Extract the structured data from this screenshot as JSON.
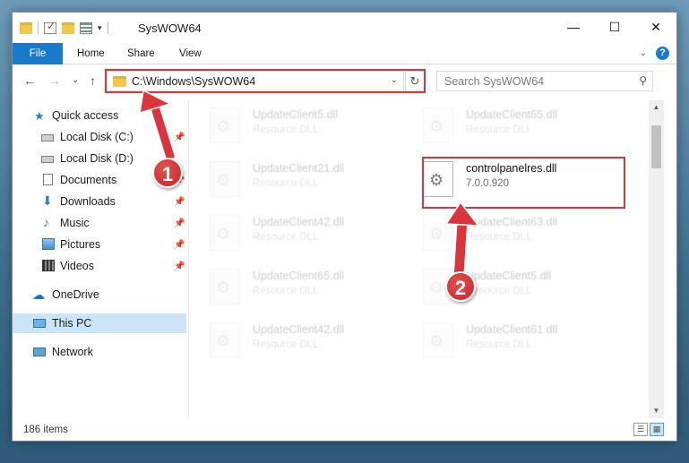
{
  "window": {
    "title": "SysWOW64",
    "minimize": "—",
    "maximize": "☐",
    "close": "✕"
  },
  "ribbon": {
    "tabs": [
      "File",
      "Home",
      "Share",
      "View"
    ],
    "expand": "⌄",
    "help": "?"
  },
  "nav": {
    "back": "←",
    "forward": "→",
    "recent": "⌄",
    "up": "↑",
    "address": "C:\\Windows\\SysWOW64",
    "address_dropdown": "⌄",
    "refresh": "↻",
    "search_placeholder": "Search SysWOW64",
    "search_icon": "⚲"
  },
  "sidebar": [
    {
      "label": "Quick access",
      "icon": "star-icon",
      "pinned": false
    },
    {
      "label": "Local Disk (C:)",
      "icon": "drive-icon",
      "pinned": true
    },
    {
      "label": "Local Disk (D:)",
      "icon": "drive-icon",
      "pinned": false
    },
    {
      "label": "Documents",
      "icon": "document-icon",
      "pinned": true
    },
    {
      "label": "Downloads",
      "icon": "download-icon",
      "pinned": true
    },
    {
      "label": "Music",
      "icon": "music-icon",
      "pinned": true
    },
    {
      "label": "Pictures",
      "icon": "pictures-icon",
      "pinned": true
    },
    {
      "label": "Videos",
      "icon": "videos-icon",
      "pinned": true
    },
    {
      "label": "OneDrive",
      "icon": "cloud-icon",
      "pinned": false
    },
    {
      "label": "This PC",
      "icon": "computer-icon",
      "pinned": false,
      "selected": true
    },
    {
      "label": "Network",
      "icon": "network-icon",
      "pinned": false
    }
  ],
  "pin_glyph": "📌",
  "files": [
    {
      "name": "UpdateClient5.dll",
      "sub": "Resource DLL"
    },
    {
      "name": "UpdateClient65.dll",
      "sub": "Resource DLL"
    },
    {
      "name": "UpdateClient21.dll",
      "sub": "Resource DLL"
    },
    {
      "name": "controlpanelres.dll",
      "sub": "7.0.0.920",
      "target": true
    },
    {
      "name": "UpdateClient42.dll",
      "sub": "Resource DLL"
    },
    {
      "name": "UpdateClient63.dll",
      "sub": "Resource DLL"
    },
    {
      "name": "UpdateClient65.dll",
      "sub": "Resource DLL"
    },
    {
      "name": "UpdateClient5.dll",
      "sub": "Resource DLL"
    },
    {
      "name": "UpdateClient42.dll",
      "sub": "Resource DLL"
    },
    {
      "name": "UpdateClient61.dll",
      "sub": "Resource DLL"
    }
  ],
  "status": {
    "count": "186 items"
  },
  "annotations": {
    "step1": "1",
    "step2": "2",
    "color": "#d9353a"
  }
}
